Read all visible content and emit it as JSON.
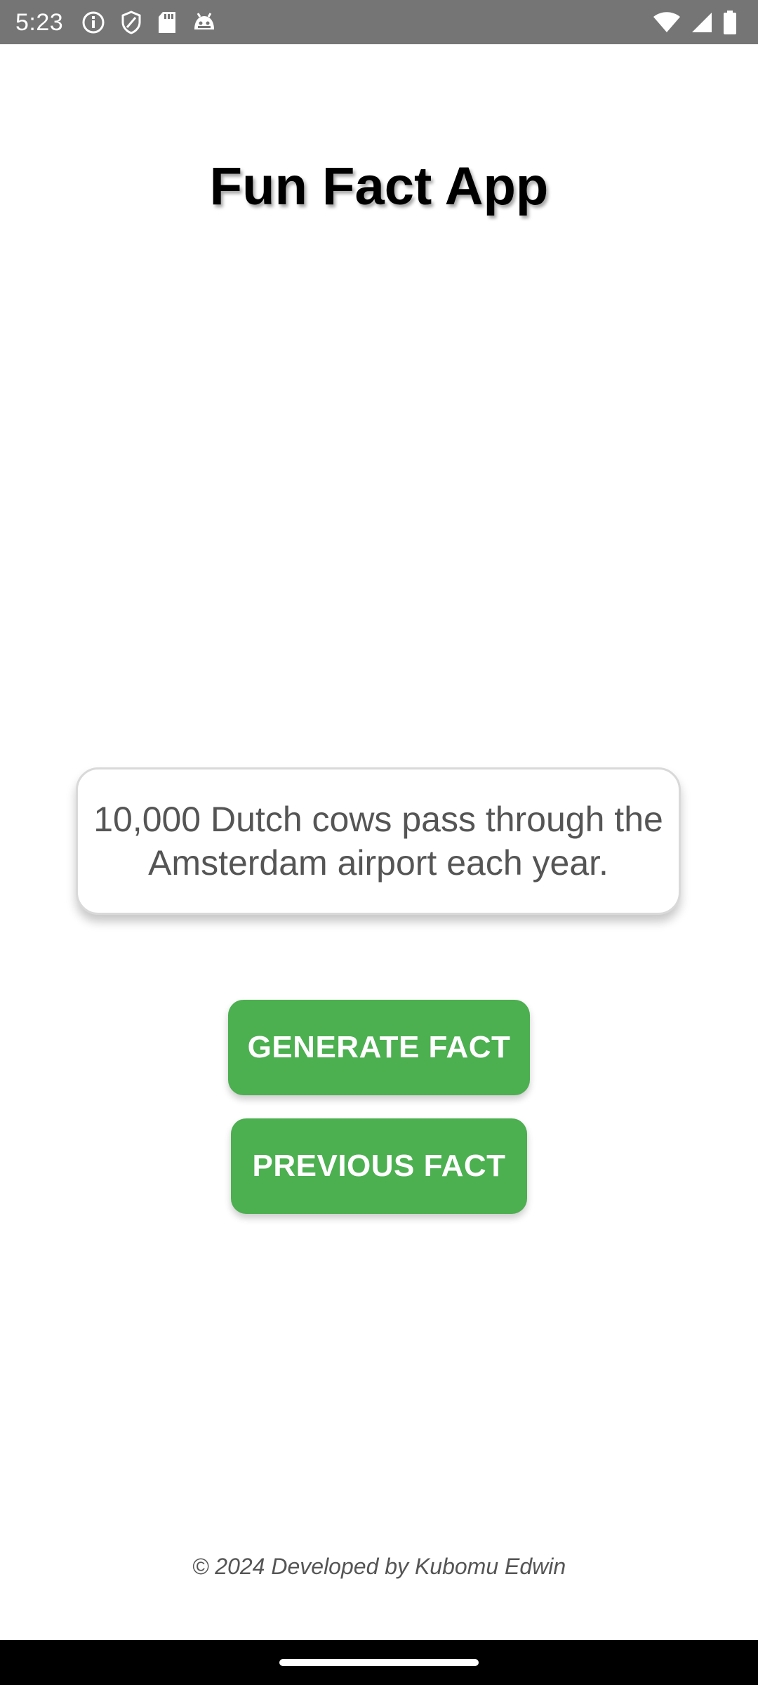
{
  "status_bar": {
    "time": "5:23",
    "left_icons": [
      "info-icon",
      "shield-icon",
      "sd-card-icon",
      "android-debug-icon"
    ],
    "right_icons": [
      "wifi-icon",
      "cell-signal-icon",
      "battery-icon"
    ]
  },
  "app": {
    "title": "Fun Fact App",
    "fact": "10,000 Dutch cows pass through the Amsterdam airport each year.",
    "generate_label": "GENERATE FACT",
    "previous_label": "PREVIOUS FACT",
    "footer": "© 2024 Developed by Kubomu Edwin"
  },
  "colors": {
    "status_bar": "#757575",
    "button": "#4caf50",
    "fact_text": "#555555"
  }
}
